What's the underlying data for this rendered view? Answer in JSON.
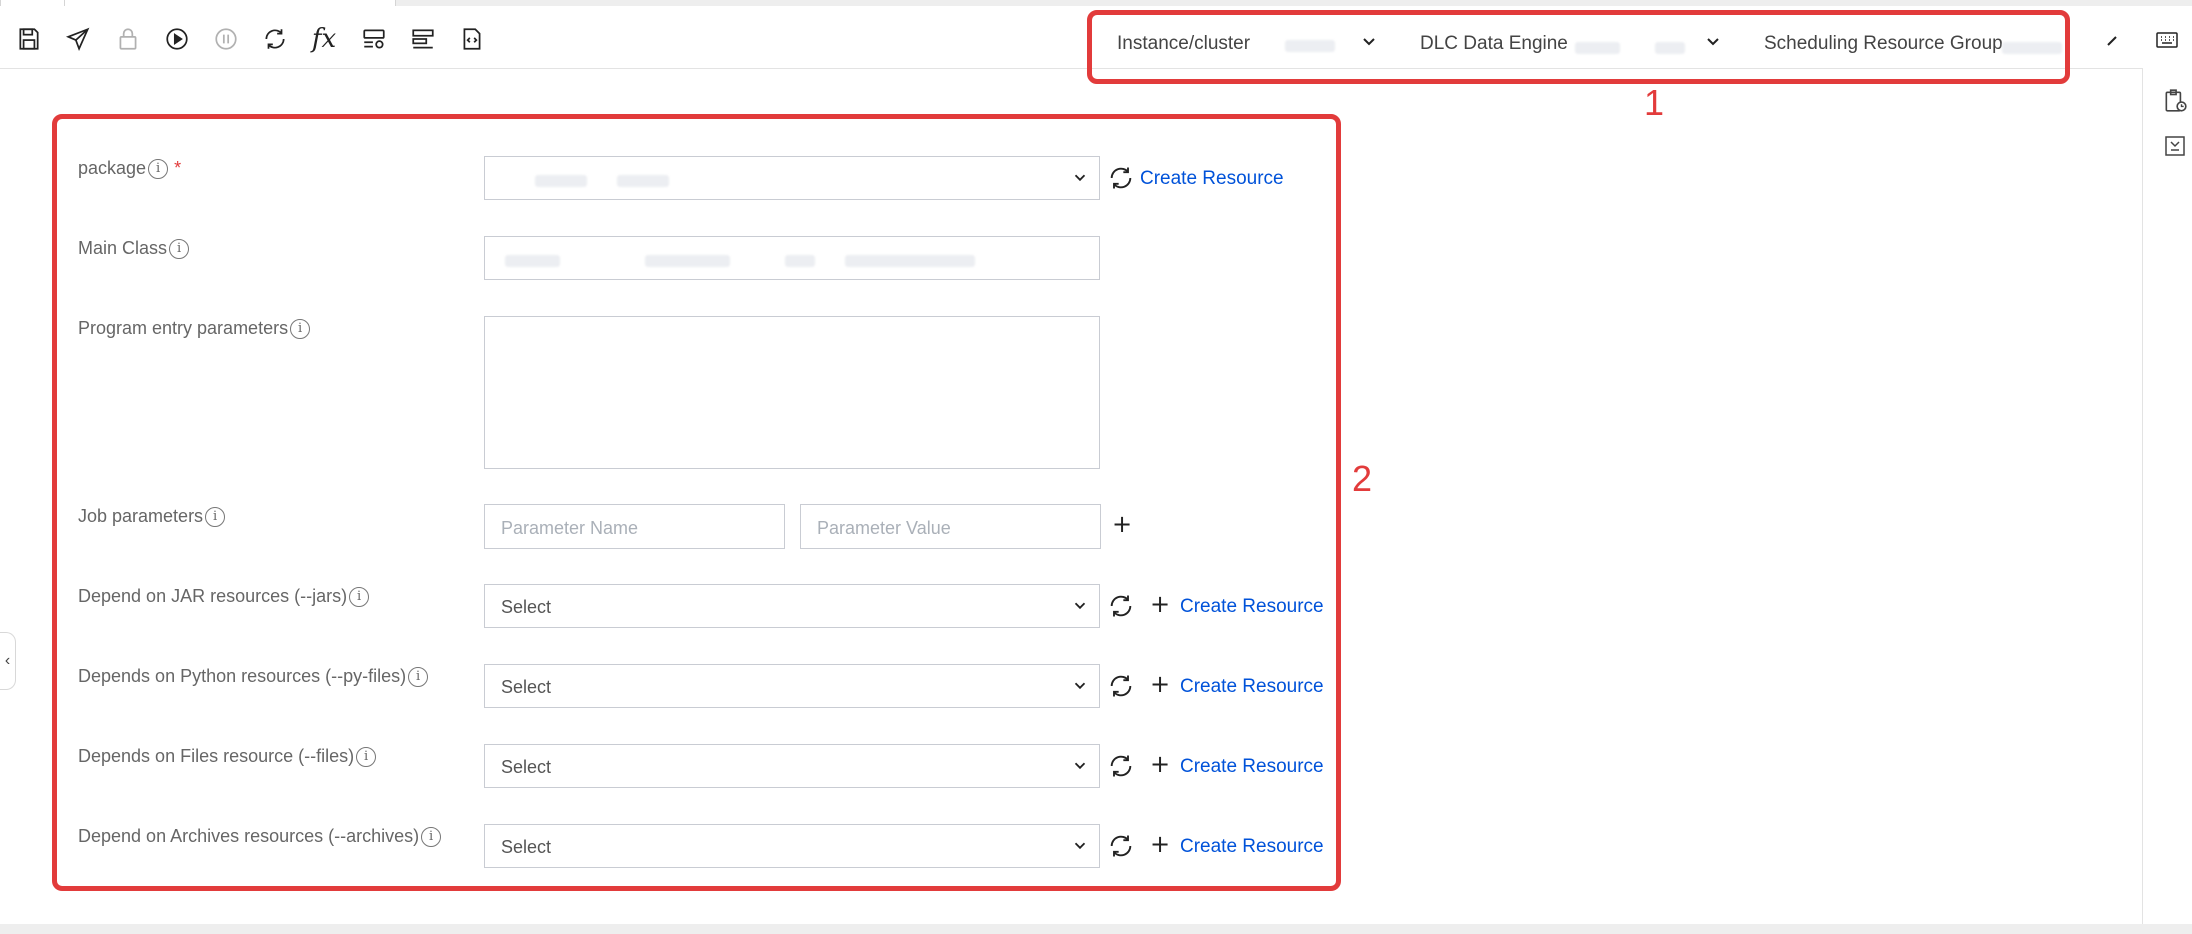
{
  "toolbar": {
    "icons": [
      "save-icon",
      "publish-icon",
      "lock-icon",
      "run-icon",
      "pause-icon",
      "refresh-icon",
      "function-icon",
      "schedule-settings-icon",
      "layout-icon",
      "code-file-icon"
    ],
    "fx_label": "fx"
  },
  "selectors": {
    "instance_label": "Instance/cluster",
    "engine_label": "DLC Data Engine",
    "resource_group_label": "Scheduling Resource Group"
  },
  "annotations": {
    "box1_number": "1",
    "box2_number": "2"
  },
  "form": {
    "package_label": "package",
    "main_class_label": "Main Class",
    "program_entry_label": "Program entry parameters",
    "job_params_label": "Job parameters",
    "param_name_placeholder": "Parameter Name",
    "param_value_placeholder": "Parameter Value",
    "add_symbol": "+",
    "info_symbol": "i",
    "required_symbol": "*",
    "create_resource": "Create Resource",
    "dependencies": [
      {
        "label": "Depend on JAR resources (--jars)",
        "placeholder": "Select"
      },
      {
        "label": "Depends on Python resources (--py-files)",
        "placeholder": "Select"
      },
      {
        "label": "Depends on Files resource (--files)",
        "placeholder": "Select"
      },
      {
        "label": "Depend on Archives resources (--archives)",
        "placeholder": "Select"
      }
    ]
  },
  "sidebar": {
    "icons": [
      "history-clipboard-icon",
      "collapse-down-icon"
    ]
  },
  "colors": {
    "annotation_red": "#e23b3b",
    "link_blue": "#0052d9",
    "border_gray": "#c9ccd3"
  }
}
